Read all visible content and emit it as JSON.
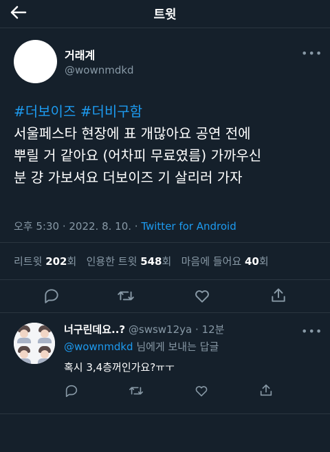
{
  "header": {
    "title": "트윗",
    "back_icon": "arrow-left-icon"
  },
  "tweet": {
    "author_name": "거래계",
    "author_handle": "@wownmdkd",
    "more_icon": "more-horizontal-icon",
    "hashtags": "#더보이즈 #더비구함",
    "lines": [
      "서울페스타 현장에 표 개많아요 공연 전에",
      "뿌릴 거 같아요 (어차피 무료였름) 가까우신",
      "분 걍 가보셔요 더보이즈 기 살리러 가자"
    ],
    "time": "오후 5:30 · 2022. 8. 10. · ",
    "source": "Twitter for Android"
  },
  "stats": {
    "retweets_label": "리트윗",
    "retweets_count": "202",
    "retweets_unit": "회",
    "quotes_label": "인용한 트윗",
    "quotes_count": "548",
    "quotes_unit": "회",
    "likes_label": "마음에 들어요",
    "likes_count": "40",
    "likes_unit": "회"
  },
  "actions": [
    "reply-icon",
    "retweet-icon",
    "like-icon",
    "share-icon"
  ],
  "reply": {
    "name": "너구린데요..?",
    "handle": "@swsw12ya",
    "dot": " · ",
    "time": "12분",
    "more_icon": "more-horizontal-icon",
    "to_mention": "@wownmdkd",
    "to_suffix": " 님에게 보내는 답글",
    "text": "혹시 3,4층꺼인가요?ㅠㅜ"
  },
  "colors": {
    "background": "#15202b",
    "accent": "#1d9bf0",
    "muted": "#8899a6",
    "divider": "#2b3640"
  }
}
